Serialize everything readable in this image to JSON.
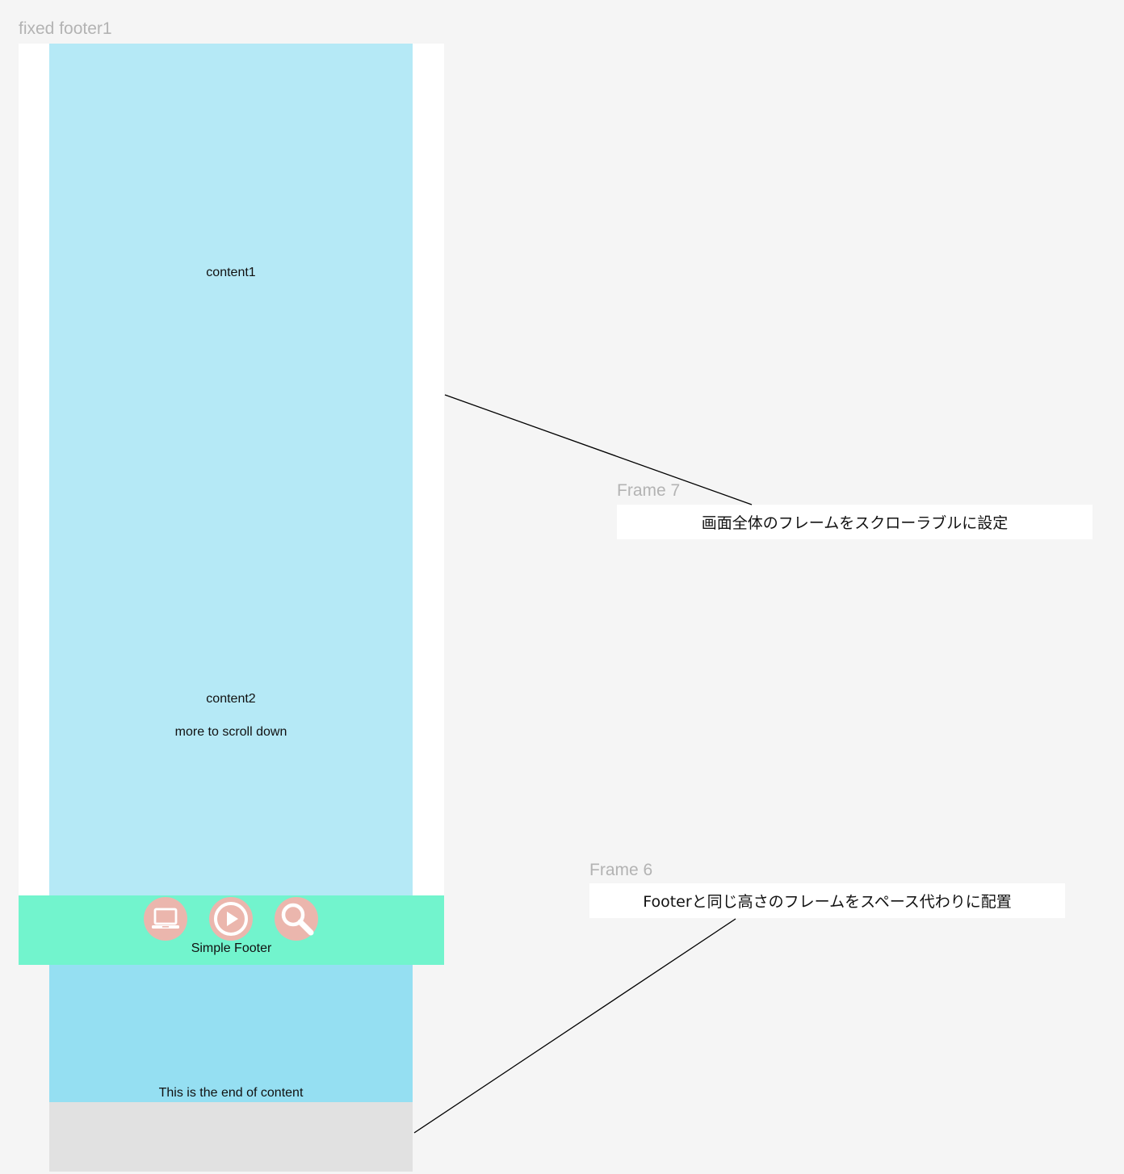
{
  "canvas": {
    "main_frame_label": "fixed footer1",
    "content1_label": "content1",
    "content2_label": "content2",
    "scroll_hint": "more to scroll down",
    "end_label": "This is the end of content"
  },
  "footer": {
    "label": "Simple Footer",
    "icons": [
      "laptop-icon",
      "play-icon",
      "search-icon"
    ]
  },
  "annotations": [
    {
      "frame_label": "Frame 7",
      "text": "画面全体のフレームをスクローラブルに設定"
    },
    {
      "frame_label": "Frame 6",
      "text": "Footerと同じ高さのフレームをスペース代わりに配置"
    }
  ],
  "colors": {
    "canvas_bg": "#f5f5f5",
    "content_bg": "#b5e9f6",
    "content_lower_bg": "#95dff2",
    "footer_bg": "#72f4cd",
    "footer_icon_bg": "#ebb6ad",
    "spacer_bg": "#e1e1e1"
  }
}
